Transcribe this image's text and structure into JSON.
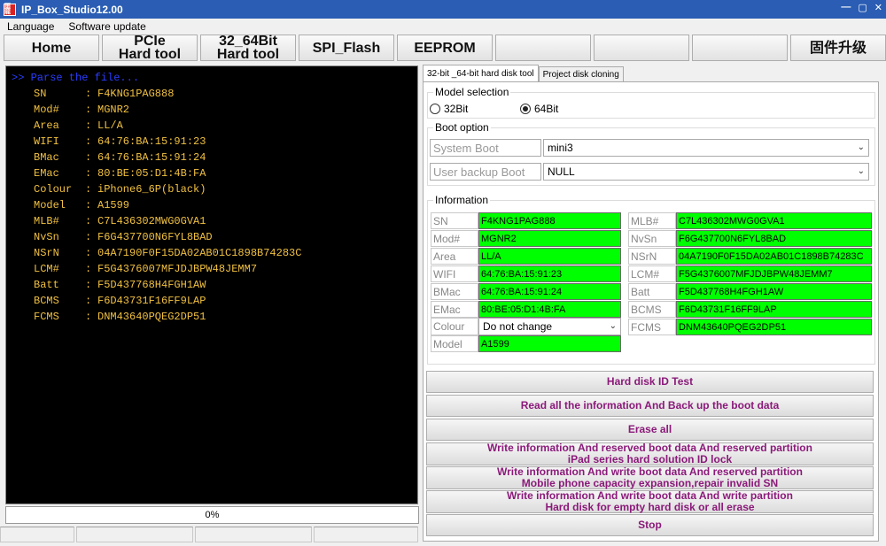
{
  "window": {
    "title": "IP_Box_Studio12.00",
    "icon_text": "雨龍",
    "controls": [
      "—",
      "▢",
      "✕"
    ]
  },
  "menu": {
    "items": [
      "Language",
      "Software update"
    ]
  },
  "nav": {
    "home": "Home",
    "pcie_1": "PCIe",
    "pcie_2": "Hard tool",
    "hd_1": "32_64Bit",
    "hd_2": "Hard tool",
    "spi": "SPI_Flash",
    "eeprom": "EEPROM",
    "upgrade": "固件升级"
  },
  "console": {
    "header": ">> Parse the file...",
    "lines": [
      {
        "key": "SN",
        "value": "F4KNG1PAG888"
      },
      {
        "key": "Mod#",
        "value": "MGNR2"
      },
      {
        "key": "Area",
        "value": "LL/A"
      },
      {
        "key": "WIFI",
        "value": "64:76:BA:15:91:23"
      },
      {
        "key": "BMac",
        "value": "64:76:BA:15:91:24"
      },
      {
        "key": "EMac",
        "value": "80:BE:05:D1:4B:FA"
      },
      {
        "key": "Colour",
        "value": "iPhone6_6P(black)"
      },
      {
        "key": "Model",
        "value": "A1599"
      },
      {
        "key": "MLB#",
        "value": "C7L436302MWG0GVA1"
      },
      {
        "key": "NvSn",
        "value": "F6G437700N6FYL8BAD"
      },
      {
        "key": "NSrN",
        "value": "04A7190F0F15DA02AB01C1898B74283C"
      },
      {
        "key": "LCM#",
        "value": "F5G4376007MFJDJBPW48JEMM7"
      },
      {
        "key": "Batt",
        "value": "F5D437768H4FGH1AW"
      },
      {
        "key": "BCMS",
        "value": "F6D43731F16FF9LAP"
      },
      {
        "key": "FCMS",
        "value": "DNM43640PQEG2DP51"
      }
    ],
    "separator": ":"
  },
  "progress": {
    "text": "0%",
    "fraction": 0
  },
  "panel": {
    "tabs": [
      "32-bit _64-bit hard disk tool",
      "Project disk cloning"
    ],
    "model_selection": {
      "label": "Model selection",
      "options": [
        "32Bit",
        "64Bit"
      ],
      "selected": "64Bit"
    },
    "boot_option": {
      "label": "Boot option",
      "system_boot_label": "System Boot",
      "system_boot_value": "mini3",
      "user_backup_label": "User backup Boot",
      "user_backup_value": "NULL"
    },
    "information": {
      "label": "Information",
      "left": [
        {
          "label": "SN",
          "value": "F4KNG1PAG888"
        },
        {
          "label": "Mod#",
          "value": "MGNR2"
        },
        {
          "label": "Area",
          "value": "LL/A"
        },
        {
          "label": "WIFI",
          "value": "64:76:BA:15:91:23"
        },
        {
          "label": "BMac",
          "value": "64:76:BA:15:91:24"
        },
        {
          "label": "EMac",
          "value": "80:BE:05:D1:4B:FA"
        }
      ],
      "colour_label": "Colour",
      "colour_value": "Do not change",
      "model_label": "Model",
      "model_value": "A1599",
      "right": [
        {
          "label": "MLB#",
          "value": "C7L436302MWG0GVA1"
        },
        {
          "label": "NvSn",
          "value": "F6G437700N6FYL8BAD"
        },
        {
          "label": "NSrN",
          "value": "04A7190F0F15DA02AB01C1898B74283C"
        },
        {
          "label": "LCM#",
          "value": "F5G4376007MFJDJBPW48JEMM7"
        },
        {
          "label": "Batt",
          "value": "F5D437768H4FGH1AW"
        },
        {
          "label": "BCMS",
          "value": "F6D43731F16FF9LAP"
        },
        {
          "label": "FCMS",
          "value": "DNM43640PQEG2DP51"
        }
      ]
    }
  },
  "actions": {
    "test": "Hard disk ID Test",
    "read": "Read all the information And Back up the boot data",
    "erase": "Erase all",
    "write1_a": "Write information And reserved boot data And reserved partition",
    "write1_b": "iPad series hard solution ID lock",
    "write2_a": "Write information And write boot data And reserved partition",
    "write2_b": "Mobile phone capacity expansion,repair invalid SN",
    "write3_a": "Write information And write boot data And write partition",
    "write3_b": "Hard disk for empty hard disk or all erase",
    "stop": "Stop"
  },
  "colors": {
    "field_green": "#00ff00",
    "action_text": "#8b1a7a",
    "console_text": "#f0c040",
    "console_parse": "#2a3dff",
    "titlebar": "#2a5db3"
  }
}
